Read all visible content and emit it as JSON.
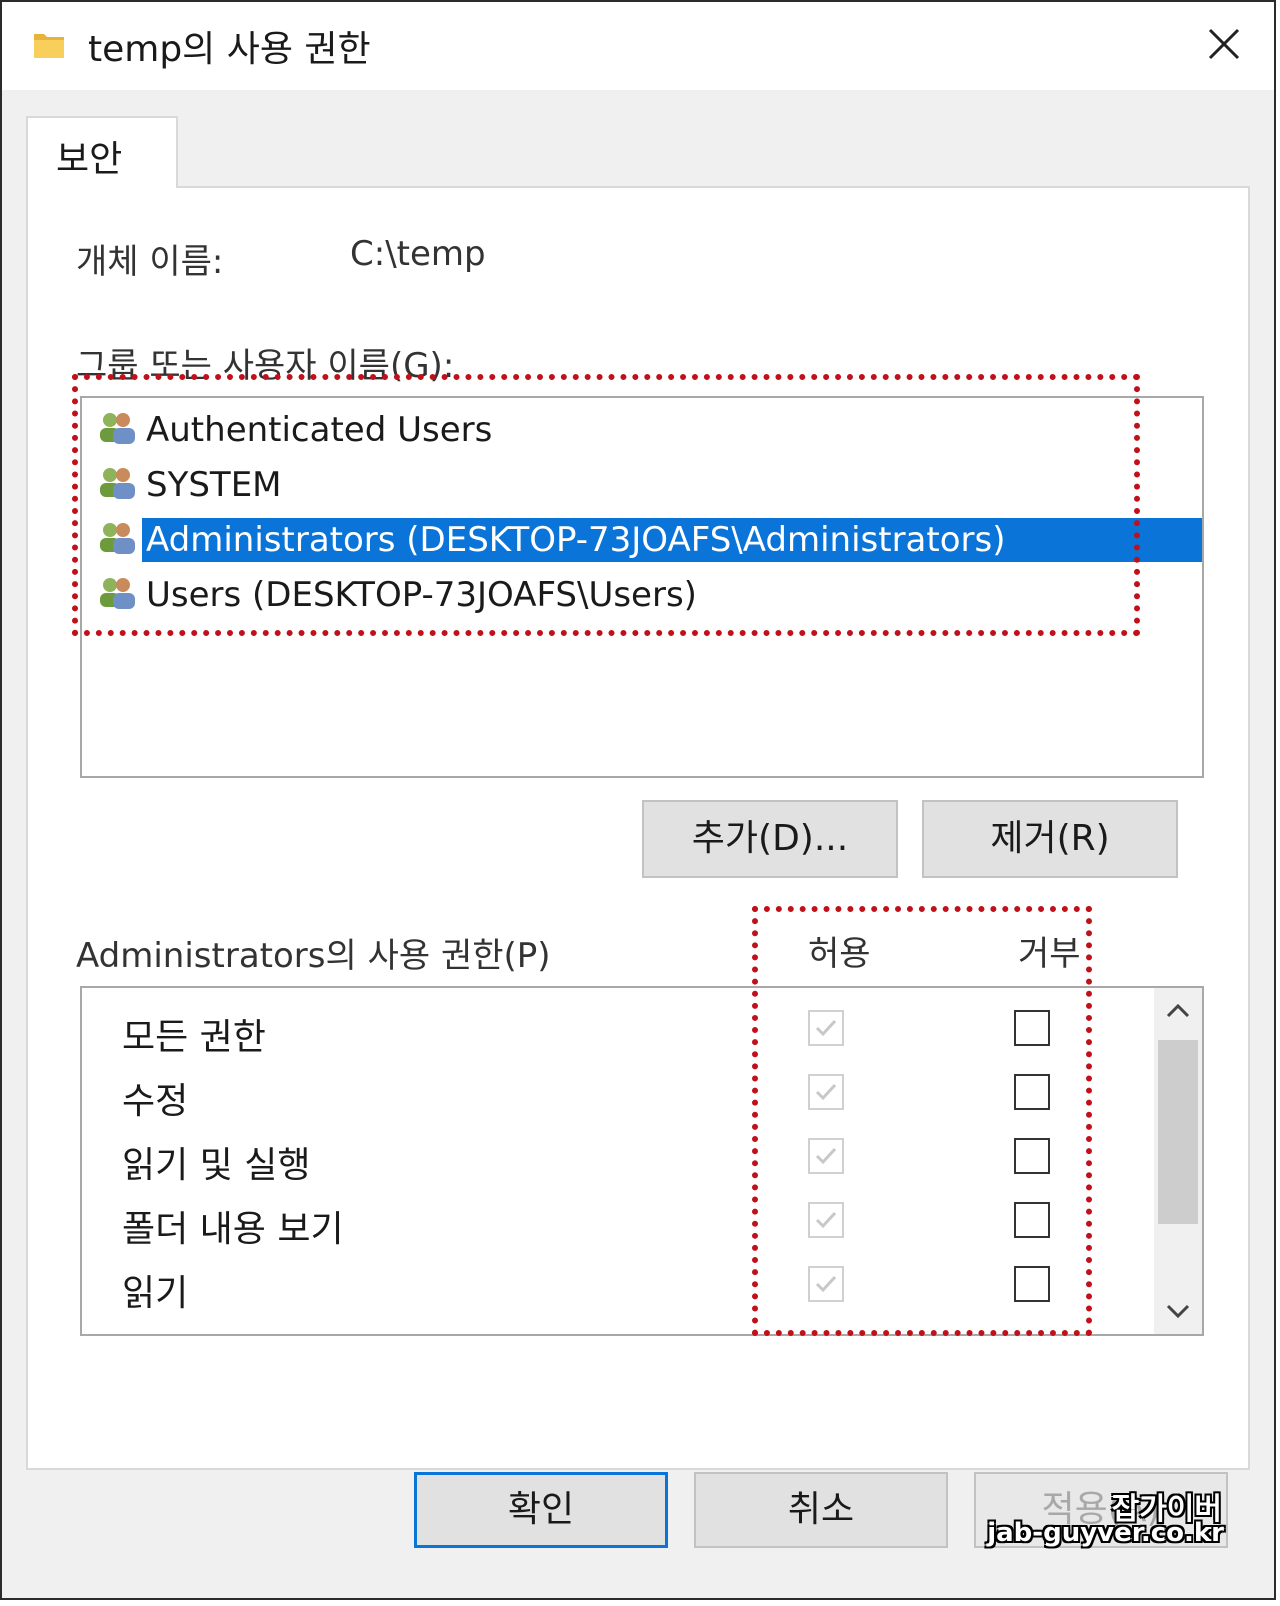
{
  "window": {
    "title": "temp의 사용 권한",
    "close_symbol": "✕"
  },
  "tabs": [
    {
      "label": "보안"
    }
  ],
  "object_name": {
    "label": "개체 이름:",
    "value": "C:\\temp"
  },
  "groups": {
    "label": "그룹 또는 사용자 이름(G):",
    "items": [
      {
        "name": "Authenticated Users",
        "selected": false
      },
      {
        "name": "SYSTEM",
        "selected": false
      },
      {
        "name": "Administrators (DESKTOP-73JOAFS\\Administrators)",
        "selected": true
      },
      {
        "name": "Users (DESKTOP-73JOAFS\\Users)",
        "selected": false
      }
    ],
    "add_label": "추가(D)...",
    "remove_label": "제거(R)"
  },
  "permissions": {
    "label": "Administrators의 사용 권한(P)",
    "allow_header": "허용",
    "deny_header": "거부",
    "rows": [
      {
        "name": "모든 권한",
        "allow": true,
        "deny": false
      },
      {
        "name": "수정",
        "allow": true,
        "deny": false
      },
      {
        "name": "읽기 및 실행",
        "allow": true,
        "deny": false
      },
      {
        "name": "폴더 내용 보기",
        "allow": true,
        "deny": false
      },
      {
        "name": "읽기",
        "allow": true,
        "deny": false
      }
    ]
  },
  "footer": {
    "ok_label": "확인",
    "cancel_label": "취소",
    "apply_label": "적용(A)"
  },
  "watermark": {
    "line1": "잡가이버",
    "line2": "jab-guyver.co.kr"
  },
  "colors": {
    "selection": "#0a74d9",
    "highlight_dotted": "#c0101a"
  }
}
